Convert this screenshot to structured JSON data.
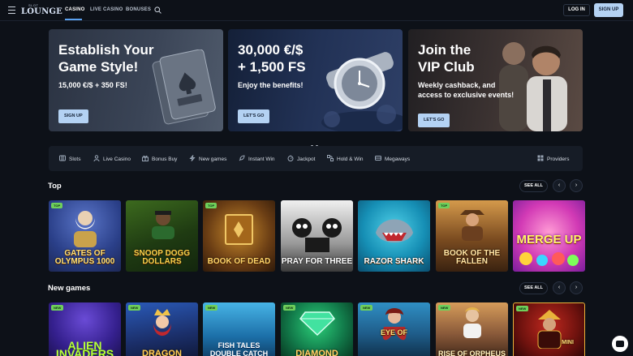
{
  "header": {
    "logo_small": "SLOT",
    "logo_word": "LOUNGE",
    "nav": [
      "CASINO",
      "LIVE CASINO",
      "BONUSES"
    ],
    "login_label": "LOG IN",
    "signup_label": "SIGN UP"
  },
  "banners": [
    {
      "title_l1": "Establish Your",
      "title_l2": "Game Style!",
      "subtitle": "15,000 €/$ + 350 FS!",
      "button": "SIGN UP"
    },
    {
      "title_l1": "30,000 €/$",
      "title_l2": "+ 1,500 FS",
      "subtitle": "Enjoy the benefits!",
      "button": "LET'S GO"
    },
    {
      "title_l1": "Join the",
      "title_l2": "VIP Club",
      "subtitle_l1": "Weekly cashback, and",
      "subtitle_l2": "access to exclusive events!",
      "button": "LET'S GO"
    }
  ],
  "categories": [
    "Slots",
    "Live Casino",
    "Bonus Buy",
    "New games",
    "Instant Win",
    "Jackpot",
    "Hold & Win",
    "Megaways"
  ],
  "providers_label": "Providers",
  "sections": {
    "top": {
      "title": "Top",
      "see_all": "SEE ALL",
      "games": [
        {
          "name": "GATES OF OLYMPUS 1000",
          "badge": "TOP"
        },
        {
          "name": "SNOOP DOGG DOLLARS",
          "badge": ""
        },
        {
          "name": "BOOK OF DEAD",
          "badge": "TOP"
        },
        {
          "name": "PRAY FOR THREE",
          "badge": ""
        },
        {
          "name": "RAZOR SHARK",
          "badge": ""
        },
        {
          "name": "BOOK OF THE FALLEN",
          "badge": "TOP"
        },
        {
          "name": "MERGE UP",
          "badge": ""
        }
      ]
    },
    "new": {
      "title": "New games",
      "see_all": "SEE ALL",
      "games": [
        {
          "name": "ALIEN INVADERS",
          "badge": "NEW"
        },
        {
          "name": "DRAGON",
          "badge": "NEW"
        },
        {
          "name": "FISH TALES DOUBLE CATCH",
          "badge": "NEW"
        },
        {
          "name": "DIAMOND",
          "badge": "NEW"
        },
        {
          "name": "EYE OF",
          "badge": "NEW"
        },
        {
          "name": "RISE OF ORPHEUS",
          "badge": "NEW"
        },
        {
          "name": "MINI",
          "badge": "NEW"
        }
      ]
    }
  },
  "colors": {
    "accent": "#b4d2f3",
    "background": "#0d1118",
    "panel": "#161c26",
    "badge": "#6fcf5b"
  }
}
